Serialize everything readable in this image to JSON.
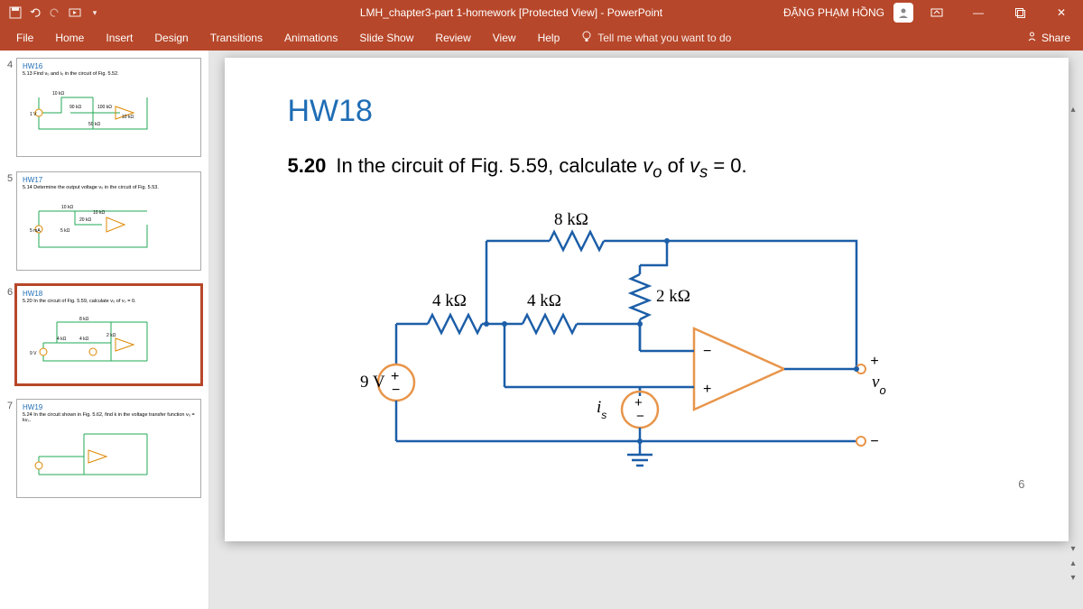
{
  "app": {
    "title": "LMH_chapter3-part 1-homework [Protected View] - PowerPoint",
    "user": "ĐẶNG PHẠM HỒNG"
  },
  "ribbon": {
    "tabs": [
      "File",
      "Home",
      "Insert",
      "Design",
      "Transitions",
      "Animations",
      "Slide Show",
      "Review",
      "View",
      "Help"
    ],
    "tellme": "Tell me what you want to do",
    "share": "Share"
  },
  "thumbs": [
    {
      "num": "4",
      "title": "HW16",
      "sub": "5.13  Find v₀ and i₀ in the circuit of Fig. 5.52."
    },
    {
      "num": "5",
      "title": "HW17",
      "sub": "5.14  Determine the output voltage v₀ in the circuit of Fig. 5.53."
    },
    {
      "num": "6",
      "title": "HW18",
      "sub": "5.20  In the circuit of Fig. 5.59, calculate v₀ of vₛ = 0."
    },
    {
      "num": "7",
      "title": "HW19",
      "sub": "5.24  In the circuit shown in Fig. 5.62, find k in the voltage transfer function v₀ = kvₛ."
    }
  ],
  "slide": {
    "title": "HW18",
    "problem_prefix": "5.20",
    "problem_text_1": "In the circuit of Fig. 5.59, calculate ",
    "problem_var1": "v",
    "problem_sub1": "o",
    "problem_text_2": " of ",
    "problem_var2": "v",
    "problem_sub2": "s",
    "problem_text_3": " = 0.",
    "labels": {
      "r_top": "8 kΩ",
      "r_left1": "4 kΩ",
      "r_left2": "4 kΩ",
      "r_right": "2 kΩ",
      "v_src": "9 V",
      "i_src": "is",
      "out": "vo"
    },
    "number_indicator": "6"
  }
}
